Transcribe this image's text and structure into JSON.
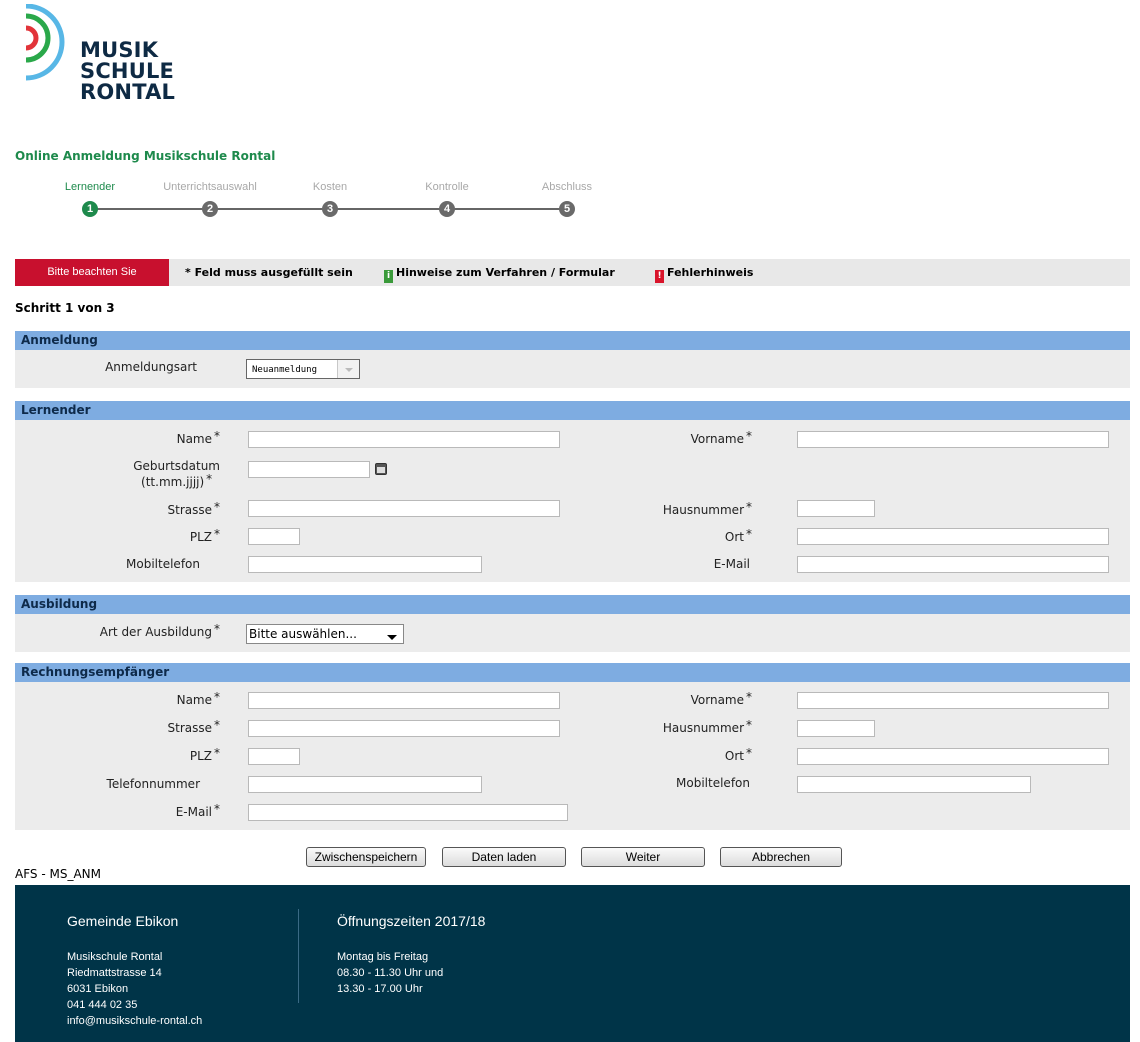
{
  "logo": {
    "line1": "MUSIK",
    "line2": "SCHULE",
    "line3": "RONTAL",
    "colors": [
      "#e2343a",
      "#2aa84a",
      "#58b7e6"
    ]
  },
  "page_title": "Online Anmeldung Musikschule Rontal",
  "stepper": {
    "steps": [
      {
        "label": "Lernender",
        "num": "1"
      },
      {
        "label": "Unterrichtsauswahl",
        "num": "2"
      },
      {
        "label": "Kosten",
        "num": "3"
      },
      {
        "label": "Kontrolle",
        "num": "4"
      },
      {
        "label": "Abschluss",
        "num": "5"
      }
    ],
    "active_step": 1
  },
  "notice": {
    "button": "Bitte beachten Sie",
    "required": "* Feld muss ausgefüllt sein",
    "info_icon": "i",
    "info": "Hinweise zum Verfahren / Formular",
    "error_icon": "!",
    "error": "Fehlerhinweis"
  },
  "step_count": "Schritt 1 von 3",
  "anmeldung": {
    "header": "Anmeldung",
    "art_label": "Anmeldungsart",
    "art_value": "Neuanmeldung"
  },
  "lernender": {
    "header": "Lernender",
    "name": "Name",
    "vorname": "Vorname",
    "geburtsdatum_1": "Geburtsdatum",
    "geburtsdatum_2": "(tt.mm.jjjj)",
    "strasse": "Strasse",
    "hausnummer": "Hausnummer",
    "plz": "PLZ",
    "ort": "Ort",
    "mobiltelefon": "Mobiltelefon",
    "email": "E-Mail"
  },
  "ausbildung": {
    "header": "Ausbildung",
    "art_label": "Art der Ausbildung",
    "art_value": "Bitte auswählen..."
  },
  "rechnung": {
    "header": "Rechnungsempfänger",
    "name": "Name",
    "vorname": "Vorname",
    "strasse": "Strasse",
    "hausnummer": "Hausnummer",
    "plz": "PLZ",
    "ort": "Ort",
    "telefon": "Telefonnummer",
    "mobiltelefon": "Mobiltelefon",
    "email": "E-Mail"
  },
  "star": "*",
  "buttons": {
    "save": "Zwischenspeichern",
    "load": "Daten laden",
    "next": "Weiter",
    "cancel": "Abbrechen"
  },
  "afs": "AFS - MS_ANM",
  "footer": {
    "left_title": "Gemeinde Ebikon",
    "left_lines": [
      "Musikschule Rontal",
      "Riedmattstrasse 14",
      "6031 Ebikon",
      "041 444 02 35",
      "info@musikschule-rontal.ch"
    ],
    "right_title": "Öffnungszeiten 2017/18",
    "right_lines": [
      "Montag bis Freitag",
      "08.30 - 11.30 Uhr und",
      "13.30 - 17.00 Uhr"
    ]
  }
}
